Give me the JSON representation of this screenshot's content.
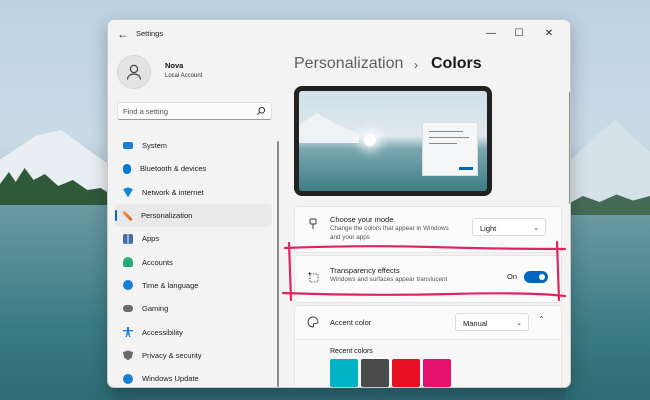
{
  "window": {
    "title": "Settings",
    "controls": {
      "minimize": "—",
      "maximize": "☐",
      "close": "✕"
    }
  },
  "profile": {
    "name": "Nova",
    "account_type": "Local Account"
  },
  "search": {
    "placeholder": "Find a setting"
  },
  "nav": {
    "items": [
      {
        "label": "System",
        "icon": "monitor-icon",
        "color": "#0078d4"
      },
      {
        "label": "Bluetooth & devices",
        "icon": "bluetooth-icon",
        "color": "#0078d4"
      },
      {
        "label": "Network & internet",
        "icon": "wifi-icon",
        "color": "#0078d4"
      },
      {
        "label": "Personalization",
        "icon": "brush-icon",
        "color": "#e07b39",
        "active": true
      },
      {
        "label": "Apps",
        "icon": "apps-icon",
        "color": "#4a6fa5"
      },
      {
        "label": "Accounts",
        "icon": "person-icon",
        "color": "#2aa876"
      },
      {
        "label": "Time & language",
        "icon": "globe-clock-icon",
        "color": "#0078d4"
      },
      {
        "label": "Gaming",
        "icon": "gamepad-icon",
        "color": "#6b6b6b"
      },
      {
        "label": "Accessibility",
        "icon": "accessibility-icon",
        "color": "#0078d4"
      },
      {
        "label": "Privacy & security",
        "icon": "shield-icon",
        "color": "#6b6b6b"
      },
      {
        "label": "Windows Update",
        "icon": "update-icon",
        "color": "#0078d4"
      }
    ]
  },
  "breadcrumb": {
    "parent": "Personalization",
    "separator": "›",
    "current": "Colors"
  },
  "mode_card": {
    "title": "Choose your mode",
    "description": "Change the colors that appear in Windows and your apps",
    "value": "Light"
  },
  "transparency_card": {
    "title": "Transparency effects",
    "description": "Windows and surfaces appear translucent",
    "state_label": "On",
    "enabled": true
  },
  "accent_card": {
    "title": "Accent color",
    "value": "Manual",
    "recent_label": "Recent colors",
    "recent_colors": [
      "#00b4c6",
      "#4a4a4a",
      "#e81123",
      "#e3106e"
    ]
  },
  "colors": {
    "accent": "#0067c0",
    "annotation": "#e0245e"
  }
}
